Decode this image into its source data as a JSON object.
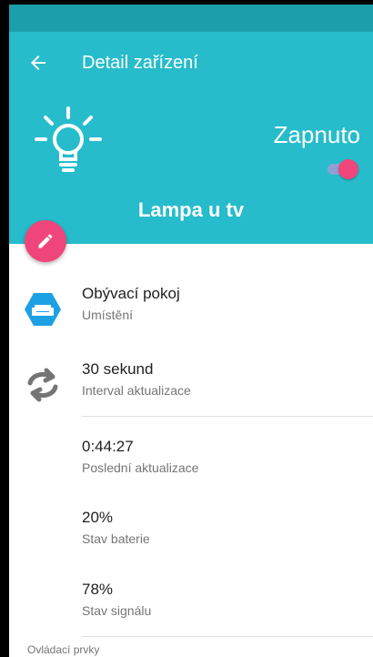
{
  "header": {
    "title": "Detail zařízení",
    "status_label": "Zapnuto",
    "device_name": "Lampa u tv",
    "toggle_on": true
  },
  "colors": {
    "statusbar": "#1d9fab",
    "header": "#26bccb",
    "accent": "#f0457b",
    "icon_blue": "#1da1e5",
    "icon_gray": "#757575"
  },
  "details": [
    {
      "icon": "sofa-icon",
      "value": "Obývací pokoj",
      "label": "Umístění"
    },
    {
      "icon": "refresh-icon",
      "value": "30 sekund",
      "label": "Interval aktualizace"
    },
    {
      "value": "0:44:27",
      "label": "Poslední aktualizace"
    },
    {
      "value": "20%",
      "label": "Stav baterie"
    },
    {
      "value": "78%",
      "label": "Stav signálu"
    }
  ],
  "footer": {
    "text": "Ovládací prvky"
  }
}
